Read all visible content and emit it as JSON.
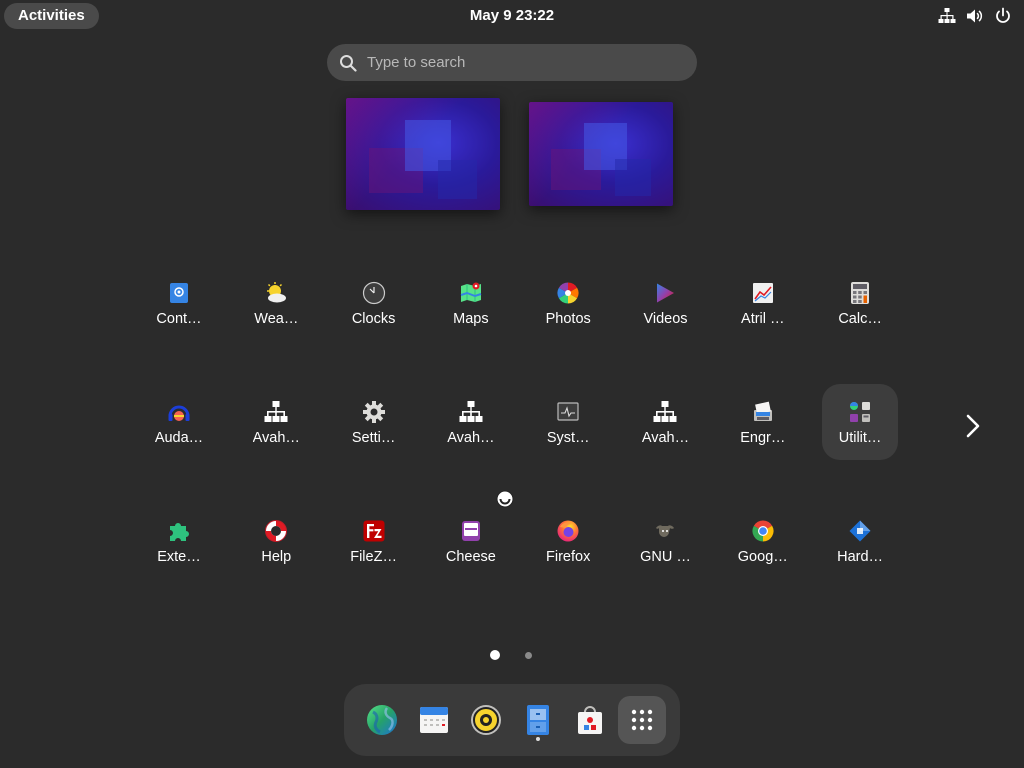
{
  "topbar": {
    "activities": "Activities",
    "clock": "May 9  23:22",
    "tray": [
      "network-icon",
      "volume-icon",
      "power-icon"
    ]
  },
  "search": {
    "placeholder": "Type to search"
  },
  "workspaces": [
    "workspace-1",
    "workspace-2"
  ],
  "apps": [
    {
      "label": "Cont…",
      "icon": "contacts-icon"
    },
    {
      "label": "Wea…",
      "icon": "weather-icon"
    },
    {
      "label": "Clocks",
      "icon": "clocks-icon"
    },
    {
      "label": "Maps",
      "icon": "maps-icon"
    },
    {
      "label": "Photos",
      "icon": "photos-icon"
    },
    {
      "label": "Videos",
      "icon": "videos-icon"
    },
    {
      "label": "Atril …",
      "icon": "atril-icon"
    },
    {
      "label": "Calc…",
      "icon": "calculator-icon"
    },
    {
      "label": "Auda…",
      "icon": "audacity-icon"
    },
    {
      "label": "Avah…",
      "icon": "avahi-network-icon"
    },
    {
      "label": "Setti…",
      "icon": "settings-gear-icon"
    },
    {
      "label": "Avah…",
      "icon": "avahi-network-icon"
    },
    {
      "label": "Syst…",
      "icon": "system-monitor-icon"
    },
    {
      "label": "Avah…",
      "icon": "avahi-network-icon"
    },
    {
      "label": "Engr…",
      "icon": "engrampa-icon"
    },
    {
      "label": "Utilit…",
      "icon": "utilities-folder-icon"
    },
    {
      "label": "Exte…",
      "icon": "extensions-puzzle-icon"
    },
    {
      "label": "Help",
      "icon": "help-lifebuoy-icon"
    },
    {
      "label": "FileZ…",
      "icon": "filezilla-icon"
    },
    {
      "label": "Cheese",
      "icon": "cheese-icon"
    },
    {
      "label": "Firefox",
      "icon": "firefox-icon"
    },
    {
      "label": "GNU …",
      "icon": "gnu-icon"
    },
    {
      "label": "Goog…",
      "icon": "chrome-icon"
    },
    {
      "label": "Hard…",
      "icon": "hardinfo-icon"
    }
  ],
  "pages": {
    "count": 2,
    "current": 1
  },
  "dash": [
    "browser-globe-icon",
    "calendar-icon",
    "rhythmbox-icon",
    "files-icon",
    "software-store-icon",
    "show-apps-grid-icon"
  ],
  "colors": {
    "background": "#2b2b2b",
    "panel": "#4a4a4a",
    "dash": "#3a3a3a",
    "text": "#ffffff"
  }
}
